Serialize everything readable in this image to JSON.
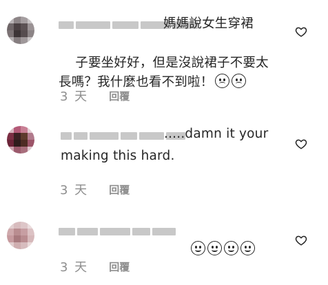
{
  "comments": [
    {
      "text_line1": "媽媽說女生穿裙",
      "text_rest": "子要坐好好，但是沒說裙子不要太\n長嗎？我什麼也看不到啦！",
      "emojis": [
        "sad-face",
        "sad-face"
      ],
      "time": "3 天",
      "reply": "回覆"
    },
    {
      "text_line1": ".....damn it your",
      "text_rest": "making this hard.",
      "emojis": [],
      "time": "3 天",
      "reply": "回覆"
    },
    {
      "text_line1": "",
      "text_rest": "",
      "emojis": [
        "laughing-face",
        "laughing-face",
        "laughing-face",
        "laughing-face"
      ],
      "time": "3 天",
      "reply": "回覆"
    }
  ],
  "icons": {
    "like": "heart-outline-icon"
  },
  "colors": {
    "text": "#262626",
    "meta": "#8e8e8e",
    "username_blur": "#9a9a9a"
  }
}
